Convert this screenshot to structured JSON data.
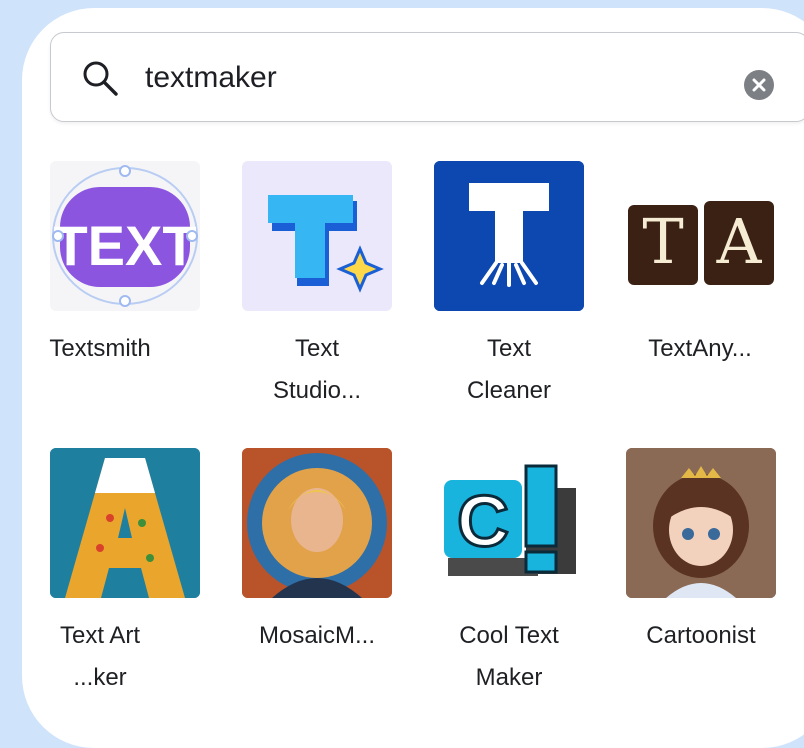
{
  "search": {
    "value": "textmaker"
  },
  "apps": [
    {
      "name_line1": "Textsmith",
      "name_line2": "",
      "icon": "textsmith-logo-icon",
      "color": "#8b55e0"
    },
    {
      "name_line1": "Text",
      "name_line2": "Studio...",
      "icon": "text-studio-logo-icon",
      "color": "#2aa9f0"
    },
    {
      "name_line1": "Text",
      "name_line2": "Cleaner",
      "icon": "text-cleaner-logo-icon",
      "color": "#0b3fa0"
    },
    {
      "name_line1": "TextAny...",
      "name_line2": "",
      "icon": "textanything-logo-icon",
      "color": "#4a2c1c"
    },
    {
      "name_line1": "Text Art",
      "name_line2": "...ker",
      "icon": "text-art-maker-logo-icon",
      "color": "#1f7f9f"
    },
    {
      "name_line1": "MosaicM...",
      "name_line2": "",
      "icon": "mosaic-maker-logo-icon",
      "color": "#c4622b"
    },
    {
      "name_line1": "Cool Text",
      "name_line2": "Maker",
      "icon": "cool-text-maker-logo-icon",
      "color": "#19b4dd"
    },
    {
      "name_line1": "Cartoonist",
      "name_line2": "",
      "icon": "cartoonist-logo-icon",
      "color": "#7a5a48"
    }
  ]
}
